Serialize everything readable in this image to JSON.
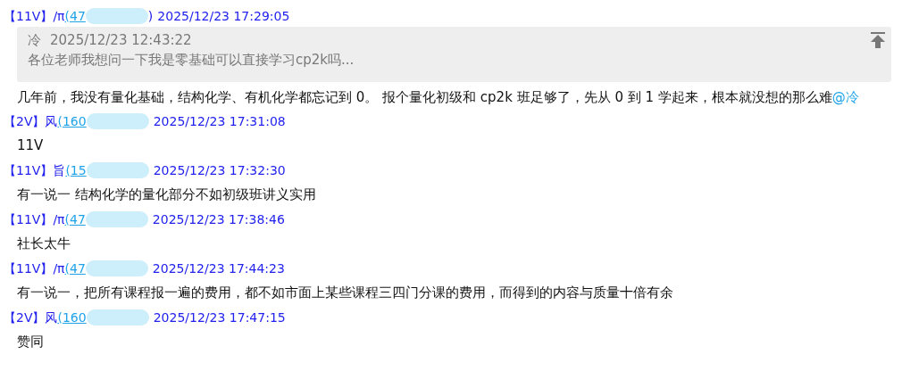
{
  "messages": [
    {
      "level": "【11V】",
      "name": "/π",
      "id": "(47",
      "close": ")",
      "time": "2025/12/23 17:29:05",
      "quote": {
        "author": "冷",
        "time": "2025/12/23 12:43:22",
        "text": "各位老师我想问一下我是零基础可以直接学习cp2k吗..."
      },
      "text": "几年前，我没有量化基础，结构化学、有机化学都忘记到 0。 报个量化初级和 cp2k 班足够了，先从 0 到 1 学起来，根本就没想的那么难",
      "mention": "@冷"
    },
    {
      "level": "【2V】",
      "name": "风",
      "id": "(160",
      "time": "2025/12/23 17:31:08",
      "text": "11V"
    },
    {
      "level": "【11V】",
      "name": "旨",
      "id": "(15",
      "time": "2025/12/23 17:32:30",
      "text": "有一说一 结构化学的量化部分不如初级班讲义实用"
    },
    {
      "level": "【11V】",
      "name": "/π",
      "id": "(47",
      "time": "2025/12/23 17:38:46",
      "text": "社长太牛"
    },
    {
      "level": "【11V】",
      "name": "/π",
      "id": "(47",
      "time": "2025/12/23 17:44:23",
      "text": "有一说一，把所有课程报一遍的费用，都不如市面上某些课程三四门分课的费用，而得到的内容与质量十倍有余"
    },
    {
      "level": "【2V】",
      "name": "风",
      "id": "(160",
      "time": "2025/12/23 17:47:15",
      "text": "赞同"
    }
  ]
}
